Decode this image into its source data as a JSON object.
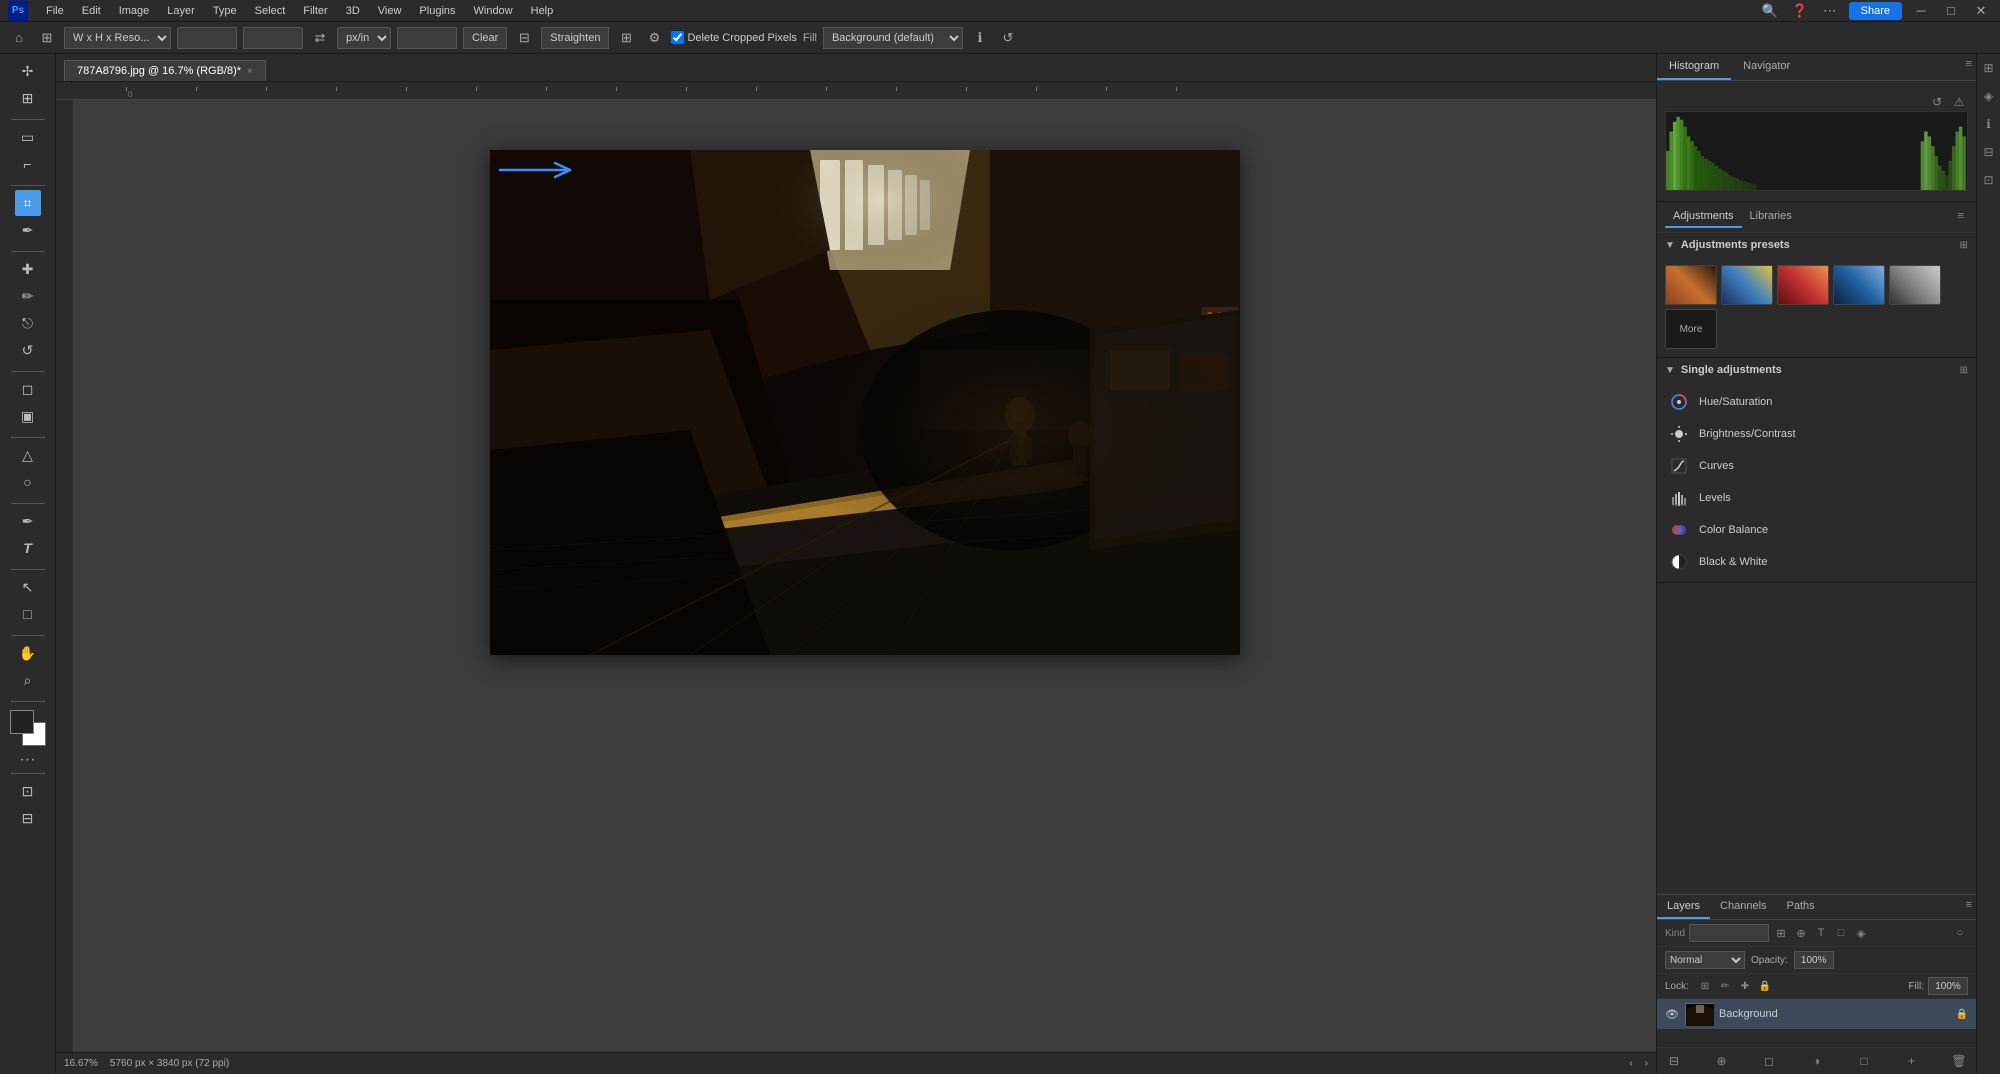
{
  "app": {
    "title": "Photoshop",
    "logo": "Ps"
  },
  "menu": {
    "items": [
      "File",
      "Edit",
      "Image",
      "Layer",
      "Type",
      "Select",
      "Filter",
      "3D",
      "View",
      "Plugins",
      "Window",
      "Help"
    ],
    "share_label": "Share"
  },
  "options_bar": {
    "size_preset": "W x H x Reso...",
    "unit": "px/in",
    "clear_label": "Clear",
    "straighten_label": "Straighten",
    "delete_cropped_label": "Delete Cropped Pixels",
    "fill_label": "Fill",
    "fill_value": "Background (default)"
  },
  "tab": {
    "name": "787A8796.jpg @ 16.7% (RGB/8)*",
    "close": "×"
  },
  "status_bar": {
    "zoom": "16.67%",
    "dimensions": "5760 px × 3840 px (72 ppi)"
  },
  "histogram": {
    "panel_tabs": [
      "Histogram",
      "Navigator"
    ],
    "active_tab": "Histogram"
  },
  "adjustments": {
    "panel_tab": "Adjustments",
    "libraries_tab": "Libraries",
    "presets_label": "Adjustments presets",
    "more_label": "More",
    "single_adj_label": "Single adjustments",
    "items": [
      {
        "id": "hue-sat",
        "label": "Hue/Saturation",
        "icon": "⊕"
      },
      {
        "id": "brightness",
        "label": "Brightness/Contrast",
        "icon": "☀"
      },
      {
        "id": "curves",
        "label": "Curves",
        "icon": "↗"
      },
      {
        "id": "levels",
        "label": "Levels",
        "icon": "▤"
      },
      {
        "id": "color-balance",
        "label": "Color Balance",
        "icon": "⊘"
      },
      {
        "id": "black-white",
        "label": "Black & White",
        "icon": "◑"
      }
    ]
  },
  "layers": {
    "tabs": [
      "Layers",
      "Channels",
      "Paths"
    ],
    "active_tab": "Layers",
    "search_placeholder": "Kind",
    "blend_mode": "Normal",
    "opacity_label": "Opacity:",
    "opacity_value": "100%",
    "lock_label": "Lock:",
    "fill_label": "Fill:",
    "fill_value": "100%",
    "items": [
      {
        "name": "Background",
        "visible": true,
        "locked": true
      }
    ]
  },
  "toolbar": {
    "tools": [
      {
        "id": "move",
        "icon": "✢",
        "label": "Move Tool"
      },
      {
        "id": "artboard",
        "icon": "⊞",
        "label": "Artboard Tool"
      },
      {
        "id": "select-rect",
        "icon": "▭",
        "label": "Rectangular Marquee"
      },
      {
        "id": "select-lasso",
        "icon": "⌐",
        "label": "Lasso Tool"
      },
      {
        "id": "crop",
        "icon": "⌗",
        "label": "Crop Tool"
      },
      {
        "id": "eyedropper",
        "icon": "✒",
        "label": "Eyedropper Tool"
      },
      {
        "id": "heal",
        "icon": "⊕",
        "label": "Healing Brush"
      },
      {
        "id": "brush",
        "icon": "✏",
        "label": "Brush Tool"
      },
      {
        "id": "clone",
        "icon": "⎋",
        "label": "Clone Stamp"
      },
      {
        "id": "history-brush",
        "icon": "↺",
        "label": "History Brush"
      },
      {
        "id": "eraser",
        "icon": "◻",
        "label": "Eraser Tool"
      },
      {
        "id": "gradient",
        "icon": "▣",
        "label": "Gradient Tool"
      },
      {
        "id": "blur",
        "icon": "△",
        "label": "Blur Tool"
      },
      {
        "id": "dodge",
        "icon": "○",
        "label": "Dodge Tool"
      },
      {
        "id": "pen",
        "icon": "✒",
        "label": "Pen Tool"
      },
      {
        "id": "type",
        "icon": "T",
        "label": "Type Tool"
      },
      {
        "id": "path-select",
        "icon": "↖",
        "label": "Path Selection"
      },
      {
        "id": "shape",
        "icon": "□",
        "label": "Shape Tool"
      },
      {
        "id": "hand",
        "icon": "✋",
        "label": "Hand Tool"
      },
      {
        "id": "zoom",
        "icon": "⌕",
        "label": "Zoom Tool"
      }
    ]
  },
  "right_icons": [
    "⊞",
    "◈",
    "ℹ",
    "⊟",
    "⊡"
  ]
}
